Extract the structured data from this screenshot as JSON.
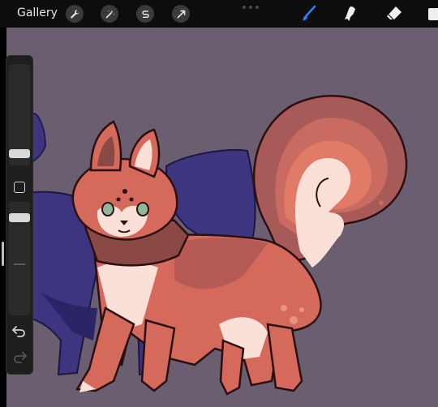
{
  "toolbar": {
    "gallery_label": "Gallery",
    "left_tools": [
      "wrench-icon",
      "magic-wand-icon",
      "selection-s-icon",
      "transform-arrow-icon"
    ],
    "right_tools": [
      "brush-icon",
      "smudge-icon",
      "eraser-icon",
      "layers-icon"
    ],
    "active_tool": "brush-icon",
    "accent_color": "#2f7ff0"
  },
  "canvas": {
    "background_color": "#6a5e70"
  },
  "sidebar": {
    "controls": [
      "brush-size-slider",
      "modify-button",
      "opacity-slider",
      "undo-button",
      "redo-button"
    ]
  }
}
